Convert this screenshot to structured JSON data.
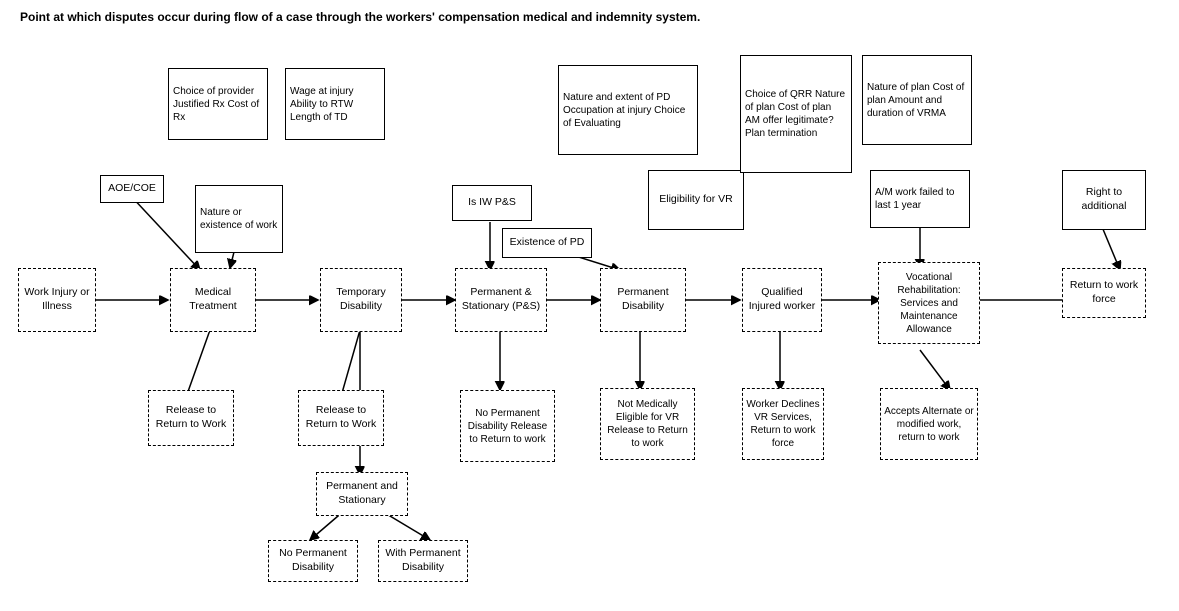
{
  "title": "Point at which disputes occur during flow of a case through the workers' compensation medical and indemnity system.",
  "boxes": {
    "work_injury": {
      "label": "Work Injury\nor Illness"
    },
    "medical_treatment": {
      "label": "Medical\nTreatment"
    },
    "temporary_disability": {
      "label": "Temporary\nDisability"
    },
    "permanent_stationary": {
      "label": "Permanent &\nStationary\n(P&S)"
    },
    "permanent_disability": {
      "label": "Permanent\nDisability"
    },
    "qualified_injured_worker": {
      "label": "Qualified\nInjured\nworker"
    },
    "vocational_rehab": {
      "label": "Vocational\nRehabilitation:\nServices and\nMaintenance\nAllowance"
    },
    "return_to_workforce": {
      "label": "Return to\nwork force"
    },
    "release_rtw_1": {
      "label": "Release to\nReturn to\nWork"
    },
    "release_rtw_2": {
      "label": "Release to\nReturn to\nWork"
    },
    "no_perm_disability_rtw": {
      "label": "No Permanent\nDisability\nRelease to\nReturn to work"
    },
    "not_medically_eligible": {
      "label": "Not Medically\nEligible for VR\nRelease to\nReturn to work"
    },
    "worker_declines": {
      "label": "Worker\nDeclines VR\nServices,\nReturn to\nwork force"
    },
    "accepts_alternate": {
      "label": "Accepts\nAlternate or\nmodified\nwork, return\nto work"
    },
    "permanent_stationary_2": {
      "label": "Permanent and\nStationary"
    },
    "no_perm_disability_2": {
      "label": "No Permanent\nDisability"
    },
    "with_perm_disability": {
      "label": "With Permanent\nDisability"
    },
    "is_iw_ps": {
      "label": "Is IW P&S"
    },
    "existence_of_pd": {
      "label": "Existence of PD"
    },
    "choice_provider": {
      "label": "Choice of\nprovider\nJustified Rx\nCost of Rx"
    },
    "wage_injury": {
      "label": "Wage at\ninjury\nAbility to RTW\nLength of TD"
    },
    "nature_existence": {
      "label": "Nature or\nexistence of\nwork"
    },
    "nature_extent_pd": {
      "label": "Nature and extent of\nPD\nOccupation at injury\nChoice of Evaluating"
    },
    "eligibility_vr": {
      "label": "Eligibility for\nVR"
    },
    "choice_qrr": {
      "label": "Choice of QRR\nNature of plan\nCost of plan\nAM offer\nlegitimate?\nPlan termination"
    },
    "nature_plan": {
      "label": "Nature of plan\nCost of plan\nAmount and\nduration of VRMA"
    },
    "am_work_failed": {
      "label": "A/M work\nfailed to last 1\nyear"
    },
    "right_additional": {
      "label": "Right to\nadditional"
    },
    "aoe_coe": {
      "label": "AOE/COE"
    }
  }
}
